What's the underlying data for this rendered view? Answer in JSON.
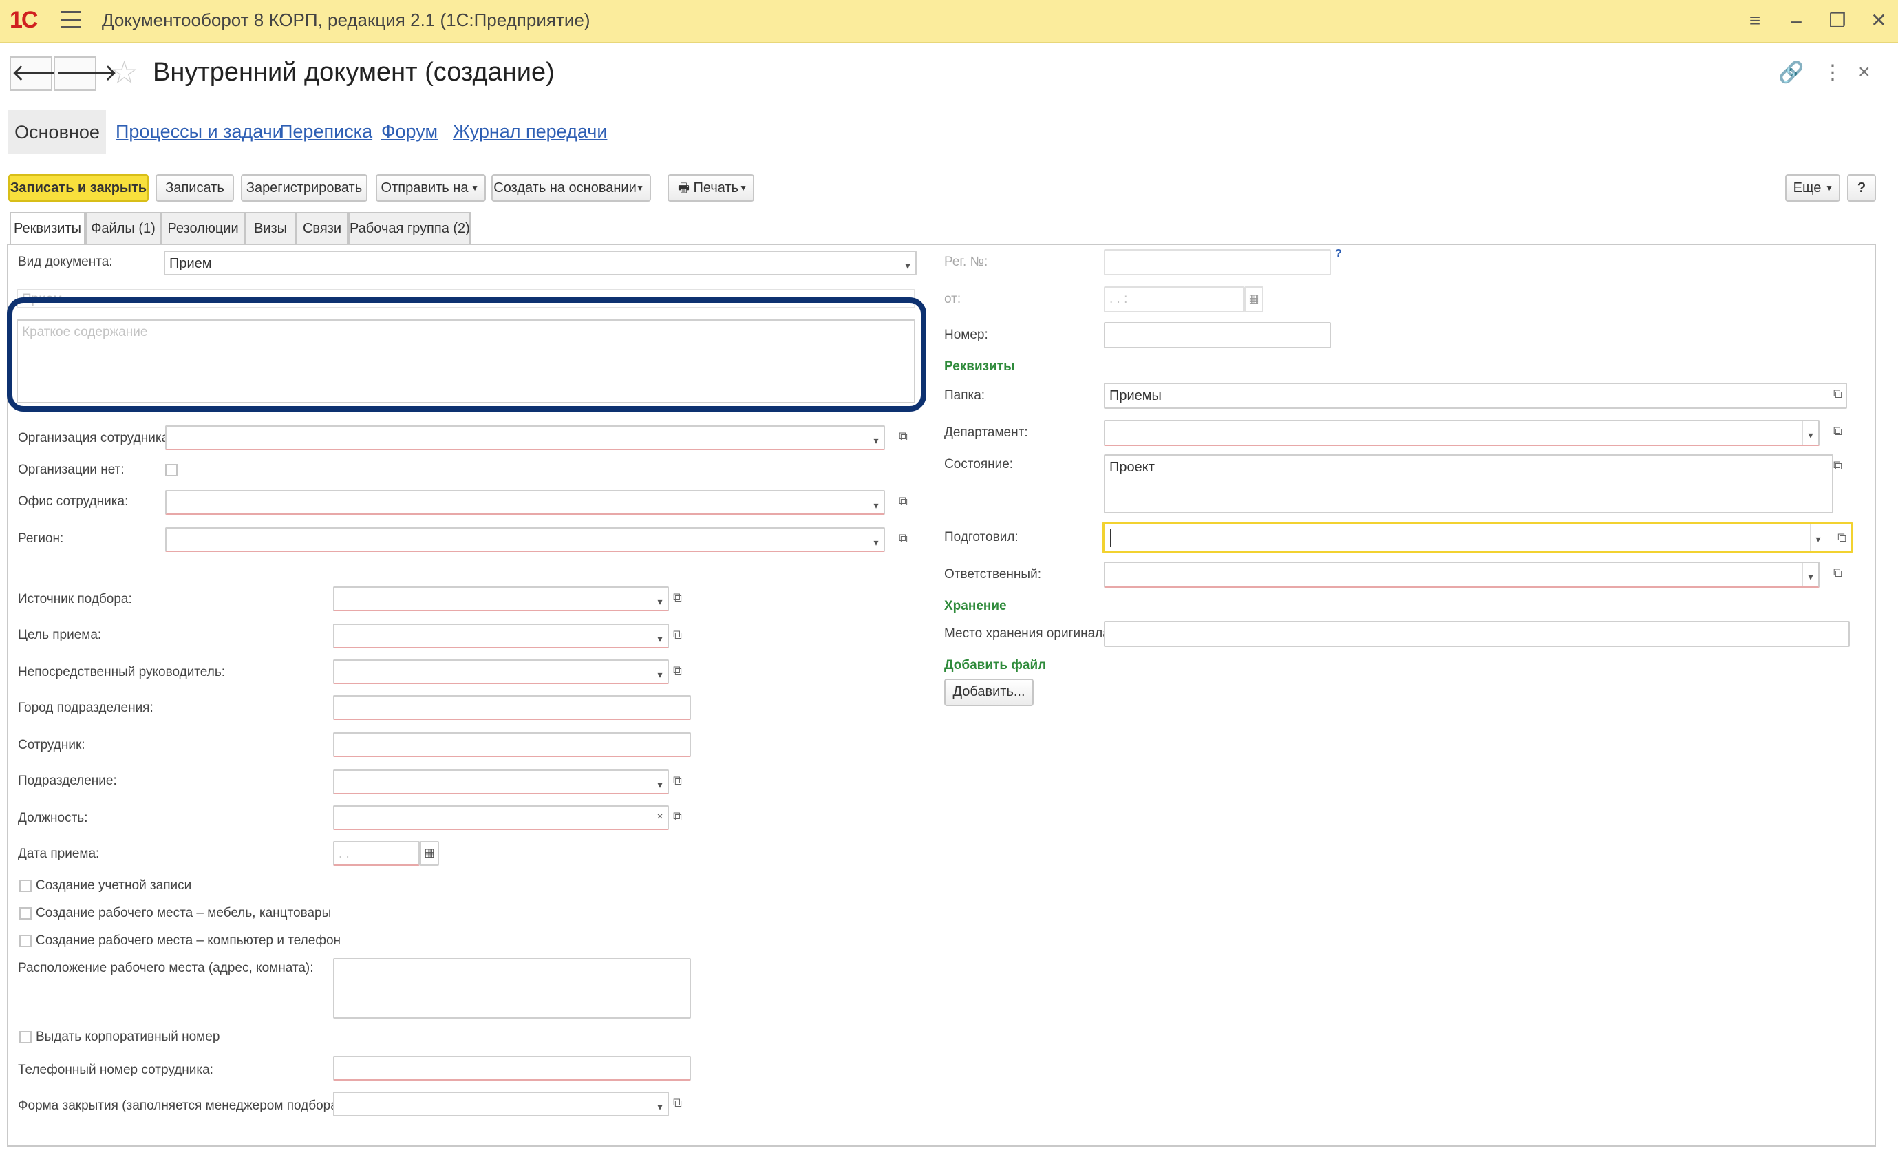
{
  "window": {
    "logo": "1С",
    "title": "Документооборот 8 КОРП, редакция 2.1 (1С:Предприятие)"
  },
  "header": {
    "page_title": "Внутренний документ (создание)"
  },
  "top_nav": {
    "active": "Основное",
    "links": [
      "Процессы и задачи",
      "Переписка",
      "Форум",
      "Журнал передачи"
    ]
  },
  "toolbar": {
    "save_close": "Записать и закрыть",
    "save": "Записать",
    "register": "Зарегистрировать",
    "send_to": "Отправить на",
    "create_based": "Создать на основании",
    "print": "Печать",
    "more": "Еще",
    "help": "?"
  },
  "sub_tabs": [
    "Реквизиты",
    "Файлы (1)",
    "Резолюции",
    "Визы",
    "Связи",
    "Рабочая группа (2)"
  ],
  "left": {
    "doc_type_label": "Вид документа:",
    "doc_type_value": "Прием",
    "title_placeholder": "Прием",
    "summary_placeholder": "Краткое содержание",
    "org_label": "Организация сотрудника:",
    "no_org_label": "Организации нет:",
    "office_label": "Офис сотрудника:",
    "region_label": "Регион:",
    "source_label": "Источник подбора:",
    "goal_label": "Цель приема:",
    "manager_label": "Непосредственный руководитель:",
    "city_label": "Город подразделения:",
    "employee_label": "Сотрудник:",
    "division_label": "Подразделение:",
    "position_label": "Должность:",
    "hire_date_label": "Дата приема:",
    "hire_date_placeholder": ". .",
    "chk_account": "Создание учетной записи",
    "chk_furniture": "Создание рабочего места – мебель, канцтовары",
    "chk_computer": "Создание рабочего места – компьютер и телефон",
    "location_label": "Расположение рабочего места (адрес, комната):",
    "chk_corp_number": "Выдать корпоративный номер",
    "phone_label": "Телефонный номер сотрудника:",
    "close_form_label": "Форма закрытия (заполняется менеджером подбора):"
  },
  "right": {
    "reg_no_label": "Рег. №:",
    "reg_help": "?",
    "from_label": "от:",
    "date_placeholder": ". .   :",
    "number_label": "Номер:",
    "section_requisites": "Реквизиты",
    "folder_label": "Папка:",
    "folder_value": "Приемы",
    "department_label": "Департамент:",
    "state_label": "Состояние:",
    "state_value": "Проект",
    "prepared_label": "Подготовил:",
    "responsible_label": "Ответственный:",
    "section_storage": "Хранение",
    "storage_label": "Место хранения оригинала:",
    "section_add_file": "Добавить файл",
    "add_button": "Добавить..."
  }
}
